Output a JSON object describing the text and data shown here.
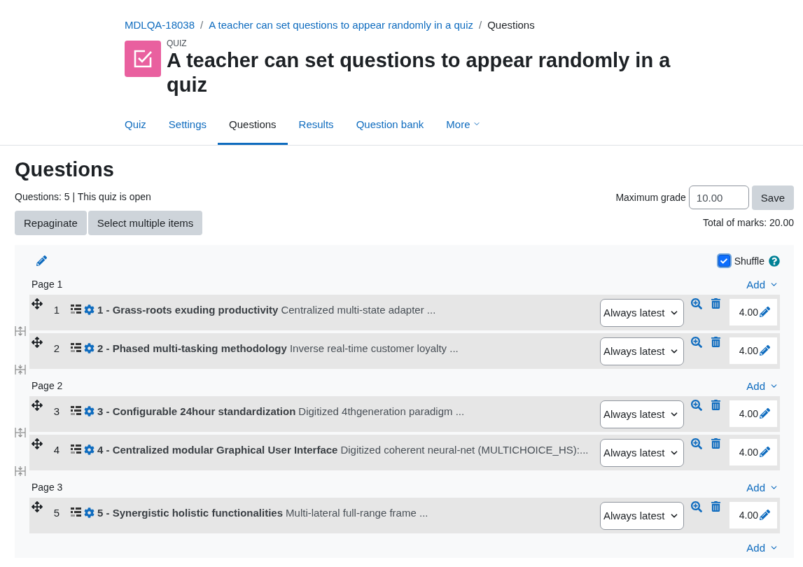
{
  "breadcrumb": [
    {
      "label": "MDLQA-18038",
      "link": true
    },
    {
      "separator": "/",
      "label": "A teacher can set questions to appear randomly in a quiz",
      "link": true
    },
    {
      "separator": "/",
      "label": "Questions",
      "link": false
    }
  ],
  "activity": {
    "type_label": "QUIZ",
    "title": "A teacher can set questions to appear randomly in a quiz"
  },
  "tabs": [
    {
      "label": "Quiz",
      "selected": false
    },
    {
      "label": "Settings",
      "selected": false
    },
    {
      "label": "Questions",
      "selected": true
    },
    {
      "label": "Results",
      "selected": false
    },
    {
      "label": "Question bank",
      "selected": false
    },
    {
      "label": "More",
      "selected": false,
      "dropdown": true
    }
  ],
  "heading": "Questions",
  "summary": "Questions: 5 | This quiz is open",
  "actions": [
    "Repaginate",
    "Select multiple items"
  ],
  "maximum_grade": {
    "label": "Maximum grade",
    "value": "10.00",
    "button": "Save"
  },
  "total_marks": "Total of marks: 20.00",
  "shuffle": {
    "label": "Shuffle",
    "checked": true
  },
  "pages": [
    {
      "label": "Page 1",
      "add": "Add",
      "questions": [
        {
          "number": "1",
          "title": "1 - Grass-roots exuding productivity",
          "text": "Centralized multi-state adapter ...",
          "version": "Always latest",
          "mark": "4.00"
        },
        {
          "number": "2",
          "title": "2 - Phased multi-tasking methodology",
          "text": "Inverse real-time customer loyalty ...",
          "version": "Always latest",
          "mark": "4.00"
        }
      ]
    },
    {
      "label": "Page 2",
      "add": "Add",
      "questions": [
        {
          "number": "3",
          "title": "3 - Configurable 24hour standardization",
          "text": "Digitized 4thgeneration paradigm ...",
          "version": "Always latest",
          "mark": "4.00"
        },
        {
          "number": "4",
          "title": "4 - Centralized modular Graphical User Interface",
          "text": "Digitized coherent neural-net (MULTICHOICE_HS):...",
          "version": "Always latest",
          "mark": "4.00"
        }
      ]
    },
    {
      "label": "Page 3",
      "add": "Add",
      "questions": [
        {
          "number": "5",
          "title": "5 - Synergistic holistic functionalities",
          "text": "Multi-lateral full-range frame ...",
          "version": "Always latest",
          "mark": "4.00"
        }
      ]
    }
  ],
  "final_add": "Add"
}
